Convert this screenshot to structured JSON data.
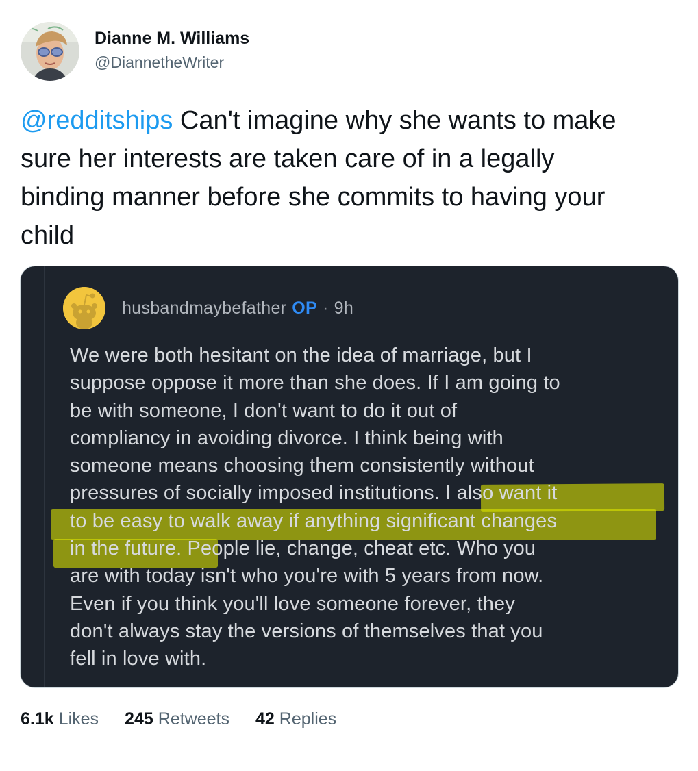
{
  "author": {
    "display_name": "Dianne M. Williams",
    "handle": "@DiannetheWriter",
    "avatar_icon": "profile-photo"
  },
  "tweet": {
    "mention": "@redditships",
    "text": " Can't imagine why she wants to make sure her interests are taken care of in a legally binding manner before she commits to having your child"
  },
  "embedded_comment": {
    "username": "husbandmaybefather",
    "op_badge": "OP",
    "separator": "·",
    "time": "9h",
    "body_lines": [
      "We were both hesitant on the idea of marriage, but I",
      "suppose oppose it more than she does. If I am going to",
      "be with someone, I don't want to do it out of",
      "compliancy in avoiding divorce. I think being with",
      "someone means choosing them consistently without",
      "pressures of socially imposed institutions. I also want it",
      "to be easy to walk away if anything significant changes",
      "in the future. People lie, change, cheat etc. Who you",
      "are with today isn't who you're with 5 years from now.",
      "Even if you think you'll love someone forever, they",
      "don't always stay the versions of themselves that you",
      "fell in love with."
    ],
    "highlight_color": "#e0e800"
  },
  "stats": {
    "likes_count": "6.1k",
    "likes_label": "Likes",
    "retweets_count": "245",
    "retweets_label": "Retweets",
    "replies_count": "42",
    "replies_label": "Replies"
  }
}
